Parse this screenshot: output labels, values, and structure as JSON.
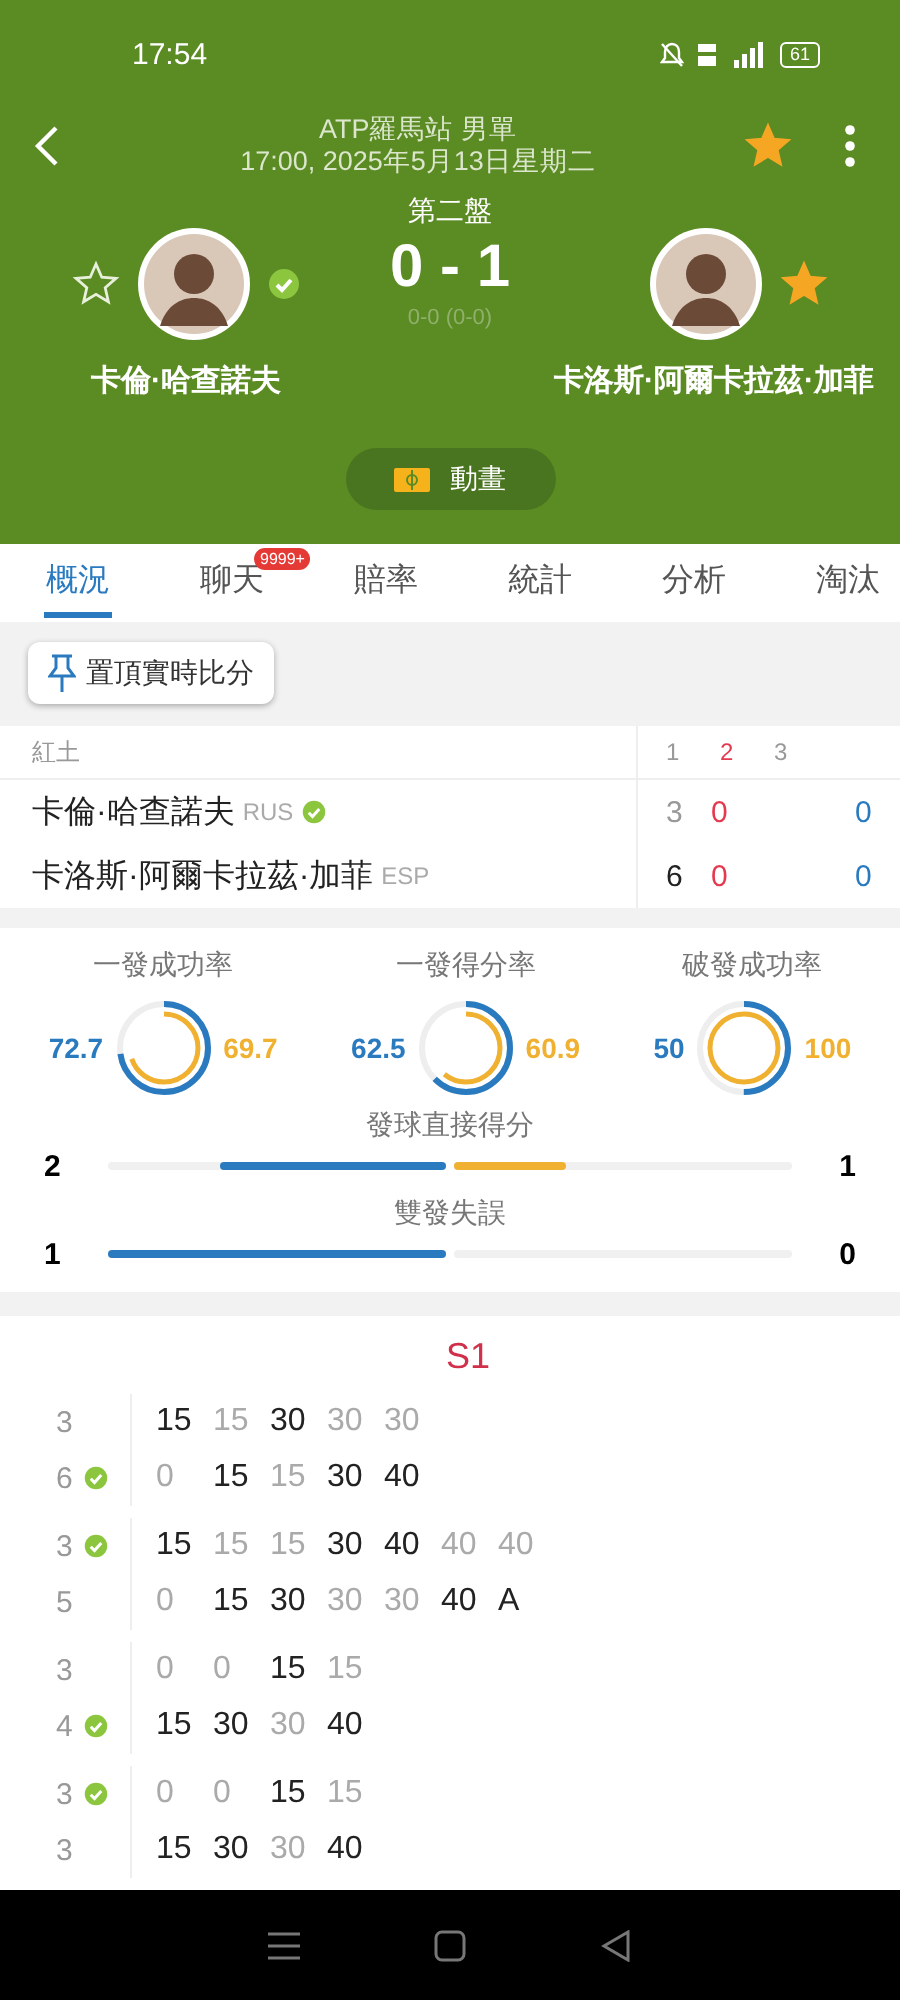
{
  "status_bar": {
    "time": "17:54",
    "battery": "61"
  },
  "header": {
    "competition": "ATP羅馬站 男單",
    "datetime": "17:00, 2025年5月13日星期二",
    "favorite": true
  },
  "match": {
    "period": "第二盤",
    "score": "0 - 1",
    "game_score": "0-0 (0-0)",
    "players": [
      {
        "name": "卡倫·哈查諾夫",
        "favorite": false,
        "serving": true
      },
      {
        "name": "卡洛斯·阿爾卡拉茲·加菲",
        "favorite": true,
        "serving": false
      }
    ]
  },
  "animation_button": "動畫",
  "tabs": [
    {
      "label": "概況",
      "selected": true
    },
    {
      "label": "聊天",
      "selected": false,
      "badge": "9999+"
    },
    {
      "label": "賠率",
      "selected": false
    },
    {
      "label": "統計",
      "selected": false
    },
    {
      "label": "分析",
      "selected": false
    },
    {
      "label": "淘汰",
      "selected": false
    }
  ],
  "pin_button": "置頂實時比分",
  "set_table": {
    "surface": "紅土",
    "columns": [
      {
        "label": "1",
        "current": false
      },
      {
        "label": "2",
        "current": true
      },
      {
        "label": "3",
        "current": false
      }
    ],
    "rows": [
      {
        "name": "卡倫·哈查諾夫",
        "country": "RUS",
        "serving": true,
        "sets": [
          {
            "value": "3",
            "won": false
          },
          {
            "value": "0"
          }
        ],
        "points": "0"
      },
      {
        "name": "卡洛斯·阿爾卡拉茲·加菲",
        "country": "ESP",
        "serving": false,
        "sets": [
          {
            "value": "6",
            "won": true
          },
          {
            "value": "0"
          }
        ],
        "points": "0"
      }
    ]
  },
  "stats": {
    "rings": [
      {
        "label": "一發成功率",
        "left": {
          "value": "72.7",
          "level": 0.727
        },
        "right": {
          "value": "69.7",
          "level": 0.697
        }
      },
      {
        "label": "一發得分率",
        "left": {
          "value": "62.5",
          "level": 0.625
        },
        "right": {
          "value": "60.9",
          "level": 0.609
        }
      },
      {
        "label": "破發成功率",
        "left": {
          "value": "50",
          "level": 0.5
        },
        "right": {
          "value": "100",
          "level": 1.0
        }
      }
    ],
    "bars": [
      {
        "label": "發球直接得分",
        "left": {
          "value": "2",
          "level": 0.67
        },
        "right": {
          "value": "1",
          "level": 0.33
        }
      },
      {
        "label": "雙發失誤",
        "left": {
          "value": "1",
          "level": 1.0
        },
        "right": {
          "value": "0",
          "level": 0
        }
      }
    ]
  },
  "point_log": {
    "title": "S1",
    "games": [
      {
        "rows": [
          {
            "games": "3",
            "serving": false,
            "points": [
              {
                "value": "15",
                "won": true
              },
              {
                "value": "15",
                "won": false
              },
              {
                "value": "30",
                "won": true
              },
              {
                "value": "30",
                "won": false
              },
              {
                "value": "30",
                "won": false
              }
            ]
          },
          {
            "games": "6",
            "serving": true,
            "points": [
              {
                "value": "0",
                "won": false
              },
              {
                "value": "15",
                "won": true
              },
              {
                "value": "15",
                "won": false
              },
              {
                "value": "30",
                "won": true
              },
              {
                "value": "40",
                "won": true
              }
            ]
          }
        ]
      },
      {
        "rows": [
          {
            "games": "3",
            "serving": true,
            "points": [
              {
                "value": "15",
                "won": true
              },
              {
                "value": "15",
                "won": false
              },
              {
                "value": "15",
                "won": false
              },
              {
                "value": "30",
                "won": true
              },
              {
                "value": "40",
                "won": true
              },
              {
                "value": "40",
                "won": false
              },
              {
                "value": "40",
                "won": false
              }
            ]
          },
          {
            "games": "5",
            "serving": false,
            "points": [
              {
                "value": "0",
                "won": false
              },
              {
                "value": "15",
                "won": true
              },
              {
                "value": "30",
                "won": true
              },
              {
                "value": "30",
                "won": false
              },
              {
                "value": "30",
                "won": false
              },
              {
                "value": "40",
                "won": true
              },
              {
                "value": "A",
                "won": true
              }
            ]
          }
        ]
      },
      {
        "rows": [
          {
            "games": "3",
            "serving": false,
            "points": [
              {
                "value": "0",
                "won": false
              },
              {
                "value": "0",
                "won": false
              },
              {
                "value": "15",
                "won": true
              },
              {
                "value": "15",
                "won": false
              }
            ]
          },
          {
            "games": "4",
            "serving": true,
            "points": [
              {
                "value": "15",
                "won": true
              },
              {
                "value": "30",
                "won": true
              },
              {
                "value": "30",
                "won": false
              },
              {
                "value": "40",
                "won": true
              }
            ]
          }
        ]
      },
      {
        "rows": [
          {
            "games": "3",
            "serving": true,
            "points": [
              {
                "value": "0",
                "won": false
              },
              {
                "value": "0",
                "won": false
              },
              {
                "value": "15",
                "won": true
              },
              {
                "value": "15",
                "won": false
              }
            ]
          },
          {
            "games": "3",
            "serving": false,
            "points": [
              {
                "value": "15",
                "won": true
              },
              {
                "value": "30",
                "won": true
              },
              {
                "value": "30",
                "won": false
              },
              {
                "value": "40",
                "won": true
              }
            ]
          }
        ]
      }
    ]
  }
}
